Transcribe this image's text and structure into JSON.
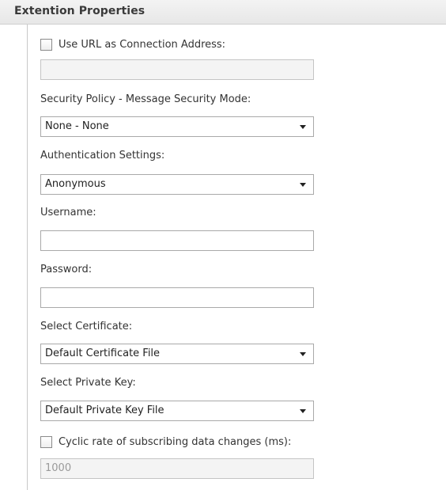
{
  "header": {
    "title": "Extention Properties"
  },
  "use_url": {
    "label": "Use URL as Connection Address:",
    "checked": false,
    "value": ""
  },
  "security_policy": {
    "label": "Security Policy - Message Security Mode:",
    "selected": "None - None"
  },
  "authentication": {
    "label": "Authentication Settings:",
    "selected": "Anonymous"
  },
  "username": {
    "label": "Username:",
    "value": ""
  },
  "password": {
    "label": "Password:",
    "value": ""
  },
  "certificate": {
    "label": "Select Certificate:",
    "selected": "Default Certificate File"
  },
  "private_key": {
    "label": "Select Private Key:",
    "selected": "Default Private Key File"
  },
  "cyclic_rate": {
    "label": "Cyclic rate of subscribing data changes (ms):",
    "checked": false,
    "value": "1000"
  }
}
